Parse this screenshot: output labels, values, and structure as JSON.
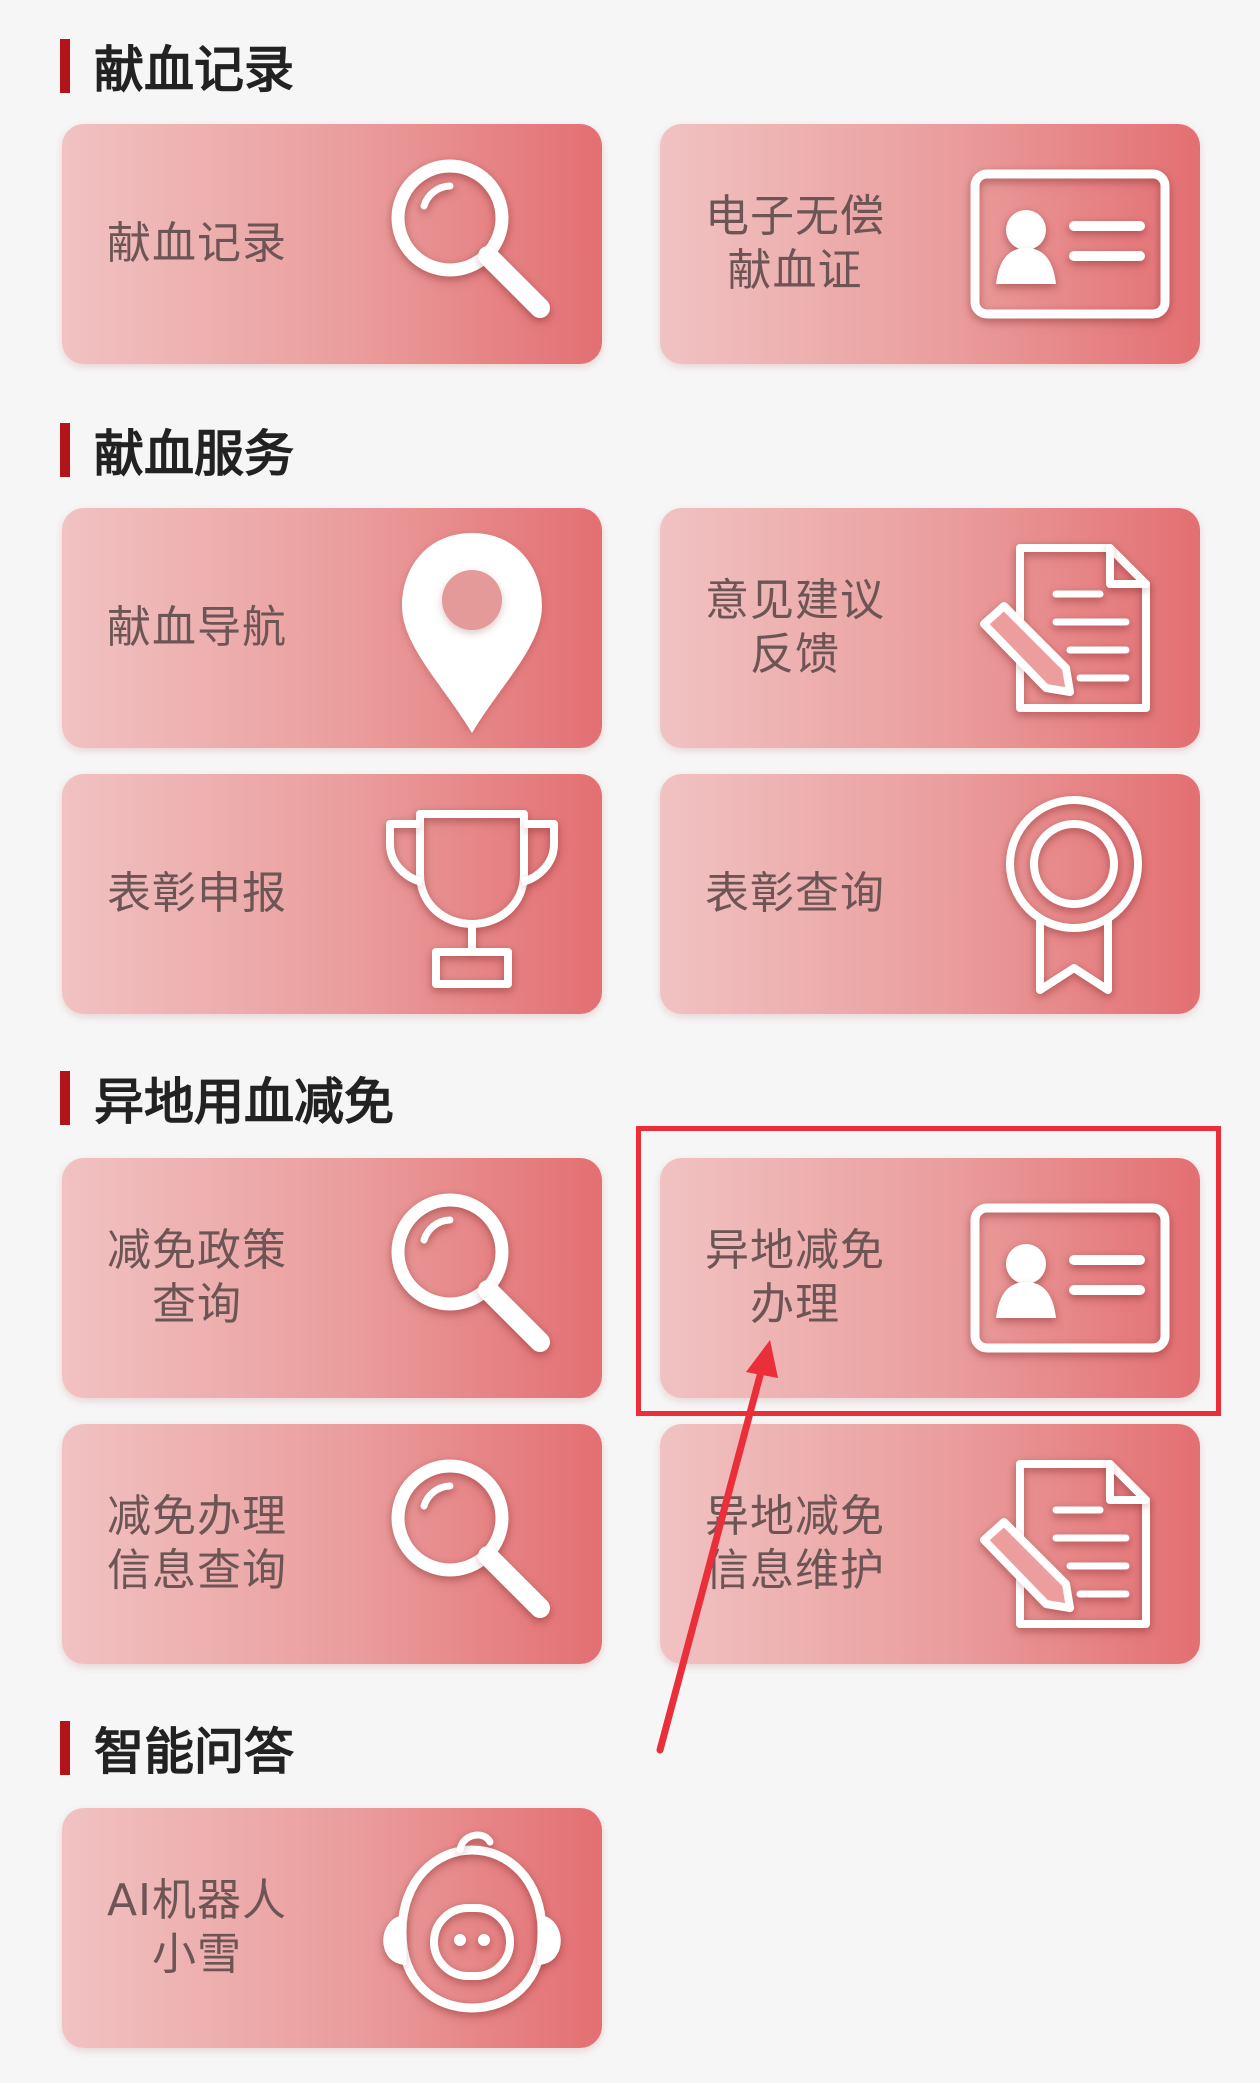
{
  "sections": [
    {
      "title": "献血记录"
    },
    {
      "title": "献血服务"
    },
    {
      "title": "异地用血减免"
    },
    {
      "title": "智能问答"
    }
  ],
  "tiles": {
    "blood_record": {
      "label": "献血记录",
      "icon": "search-icon"
    },
    "e_certificate": {
      "label": "电子无偿\n献血证",
      "icon": "id-card-icon"
    },
    "navigation": {
      "label": "献血导航",
      "icon": "location-pin-icon"
    },
    "feedback": {
      "label": "意见建议\n反馈",
      "icon": "document-edit-icon"
    },
    "commendation_apply": {
      "label": "表彰申报",
      "icon": "trophy-icon"
    },
    "commendation_query": {
      "label": "表彰查询",
      "icon": "medal-ribbon-icon"
    },
    "policy_query": {
      "label": "减免政策\n查询",
      "icon": "search-icon"
    },
    "remote_apply": {
      "label": "异地减免\n办理",
      "icon": "id-card-icon"
    },
    "apply_info_query": {
      "label": "减免办理\n信息查询",
      "icon": "search-icon"
    },
    "remote_info_maintain": {
      "label": "异地减免\n信息维护",
      "icon": "document-edit-icon"
    },
    "ai_robot": {
      "label": "AI机器人\n小雪",
      "icon": "robot-icon"
    }
  },
  "annotation": {
    "highlight_color": "#ea2e3a"
  },
  "colors": {
    "section_bar": "#b3141a",
    "tile_start": "#f1c2c2",
    "tile_end": "#e36f72",
    "tile_text": "#6e5555"
  }
}
